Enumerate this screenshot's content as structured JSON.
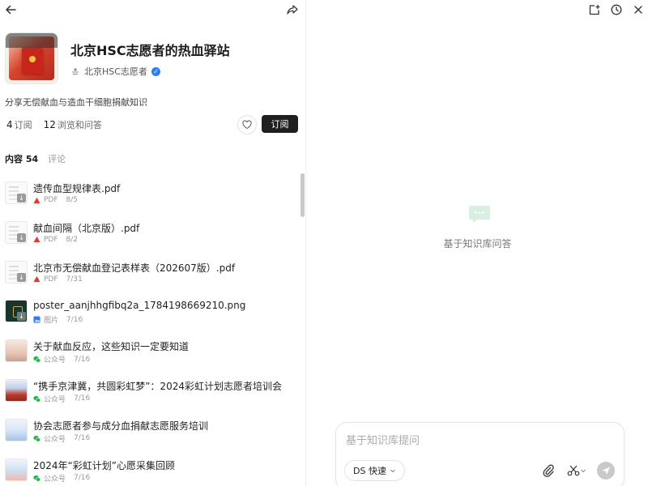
{
  "left_panel": {
    "knowledge_base": {
      "title": "北京HSC志愿者的热血驿站",
      "owner": "北京HSC志愿者",
      "description": "分享无偿献血与造血干细胞捐献知识",
      "subscribers_count": "4",
      "subscribers_label": "订阅",
      "views_count": "12",
      "views_label": "浏览和问答",
      "subscribe_label": "订阅"
    },
    "tabs": {
      "content_label": "内容 54",
      "comments_label": "评论"
    },
    "items": [
      {
        "title": "遗传血型规律表.pdf",
        "type": "PDF",
        "date": "8/5",
        "thumb": "doc"
      },
      {
        "title": "献血间隔（北京版）.pdf",
        "type": "PDF",
        "date": "8/2",
        "thumb": "doc"
      },
      {
        "title": "北京市无偿献血登记表样表（202607版）.pdf",
        "type": "PDF",
        "date": "7/31",
        "thumb": "doc"
      },
      {
        "title": "poster_aanjhhgfibq2a_1784198669210.png",
        "type": "图片",
        "date": "7/16",
        "thumb": "img"
      },
      {
        "title": "关于献血反应，这些知识一定要知道",
        "type": "公众号",
        "date": "7/16",
        "thumb": "wx1"
      },
      {
        "title": "“携手京津冀，共圆彩虹梦”：2024彩虹计划志愿者培训会",
        "type": "公众号",
        "date": "7/16",
        "thumb": "wx2"
      },
      {
        "title": "协会志愿者参与成分血捐献志愿服务培训",
        "type": "公众号",
        "date": "7/16",
        "thumb": "wx3"
      },
      {
        "title": "2024年“彩虹计划”心愿采集回顾",
        "type": "公众号",
        "date": "7/16",
        "thumb": "wx4"
      }
    ]
  },
  "right_panel": {
    "empty_state_text": "基于知识库问答",
    "composer": {
      "placeholder": "基于知识库提问",
      "model_label": "DS 快速"
    }
  },
  "colors": {
    "pdf": "#e23a2e",
    "image": "#2f7cf6",
    "wechat": "#20b84a",
    "verified": "#2b7ff5",
    "subscribe_button": "#1f1f1f"
  }
}
